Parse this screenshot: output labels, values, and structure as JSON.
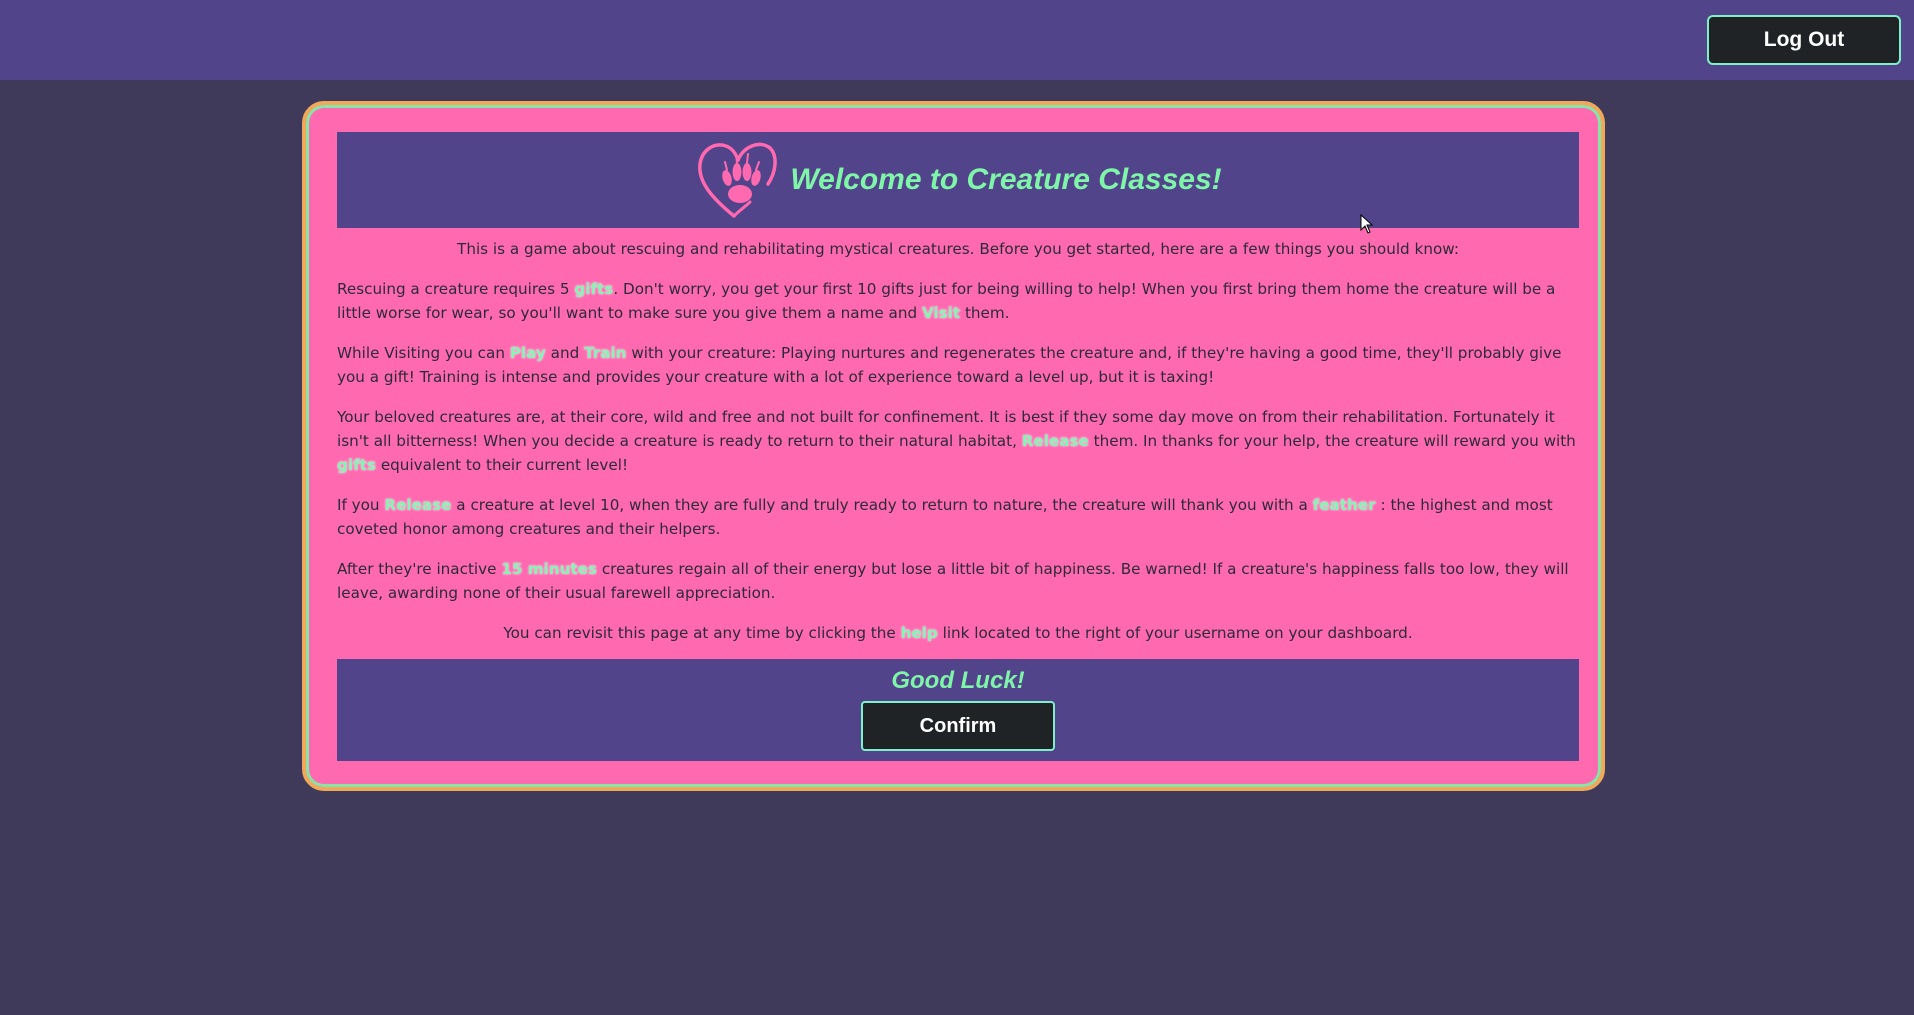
{
  "header": {
    "logout_label": "Log Out"
  },
  "welcome": {
    "title": "Welcome to Creature Classes!"
  },
  "intro": {
    "p1": "This is a game about rescuing and rehabilitating mystical creatures. Before you get started, here are a few things you should know:",
    "p2": {
      "t1": "Rescuing a creature requires 5 ",
      "h1": "gifts",
      "t2": ". Don't worry, you get your first 10 gifts just for being willing to help! When you first bring them home the creature will be a little worse for wear, so you'll want to make sure you give them a name and ",
      "h2": "Visit",
      "t3": " them."
    },
    "p3": {
      "t1": "While Visiting you can ",
      "h1": "Play",
      "t2": " and ",
      "h2": "Train",
      "t3": " with your creature: Playing nurtures and regenerates the creature and, if they're having a good time, they'll probably give you a gift! Training is intense and provides your creature with a lot of experience toward a level up, but it is taxing!"
    },
    "p4": {
      "t1": "Your beloved creatures are, at their core, wild and free and not built for confinement. It is best if they some day move on from their rehabilitation. Fortunately it isn't all bitterness! When you decide a creature is ready to return to their natural habitat, ",
      "h1": "Release",
      "t2": " them. In thanks for your help, the creature will reward you with ",
      "h2": "gifts",
      "t3": " equivalent to their current level!"
    },
    "p5": {
      "t1": "If you ",
      "h1": "Release",
      "t2": " a creature at level 10, when they are fully and truly ready to return to nature, the creature will thank you with a ",
      "h2": "feather",
      "t3": " : the highest and most coveted honor among creatures and their helpers."
    },
    "p6": {
      "t1": "After they're inactive ",
      "h1": "15 minutes",
      "t2": " creatures regain all of their energy but lose a little bit of happiness. Be warned! If a creature's happiness falls too low, they will leave, awarding none of their usual farewell appreciation."
    },
    "p7": {
      "t1": "You can revisit this page at any time by clicking the ",
      "h1": "help",
      "t2": " link located to the right of your username on your dashboard."
    }
  },
  "footer": {
    "good_luck": "Good Luck!",
    "confirm_label": "Confirm"
  },
  "colors": {
    "page_bg": "#403a5a",
    "topbar": "#51448a",
    "card": "#ff69b0",
    "accent_green": "#7ef5a8",
    "button": "#1f2326"
  },
  "icons": {
    "logo": "heart-paw-icon",
    "cursor": "mouse-pointer-icon"
  }
}
